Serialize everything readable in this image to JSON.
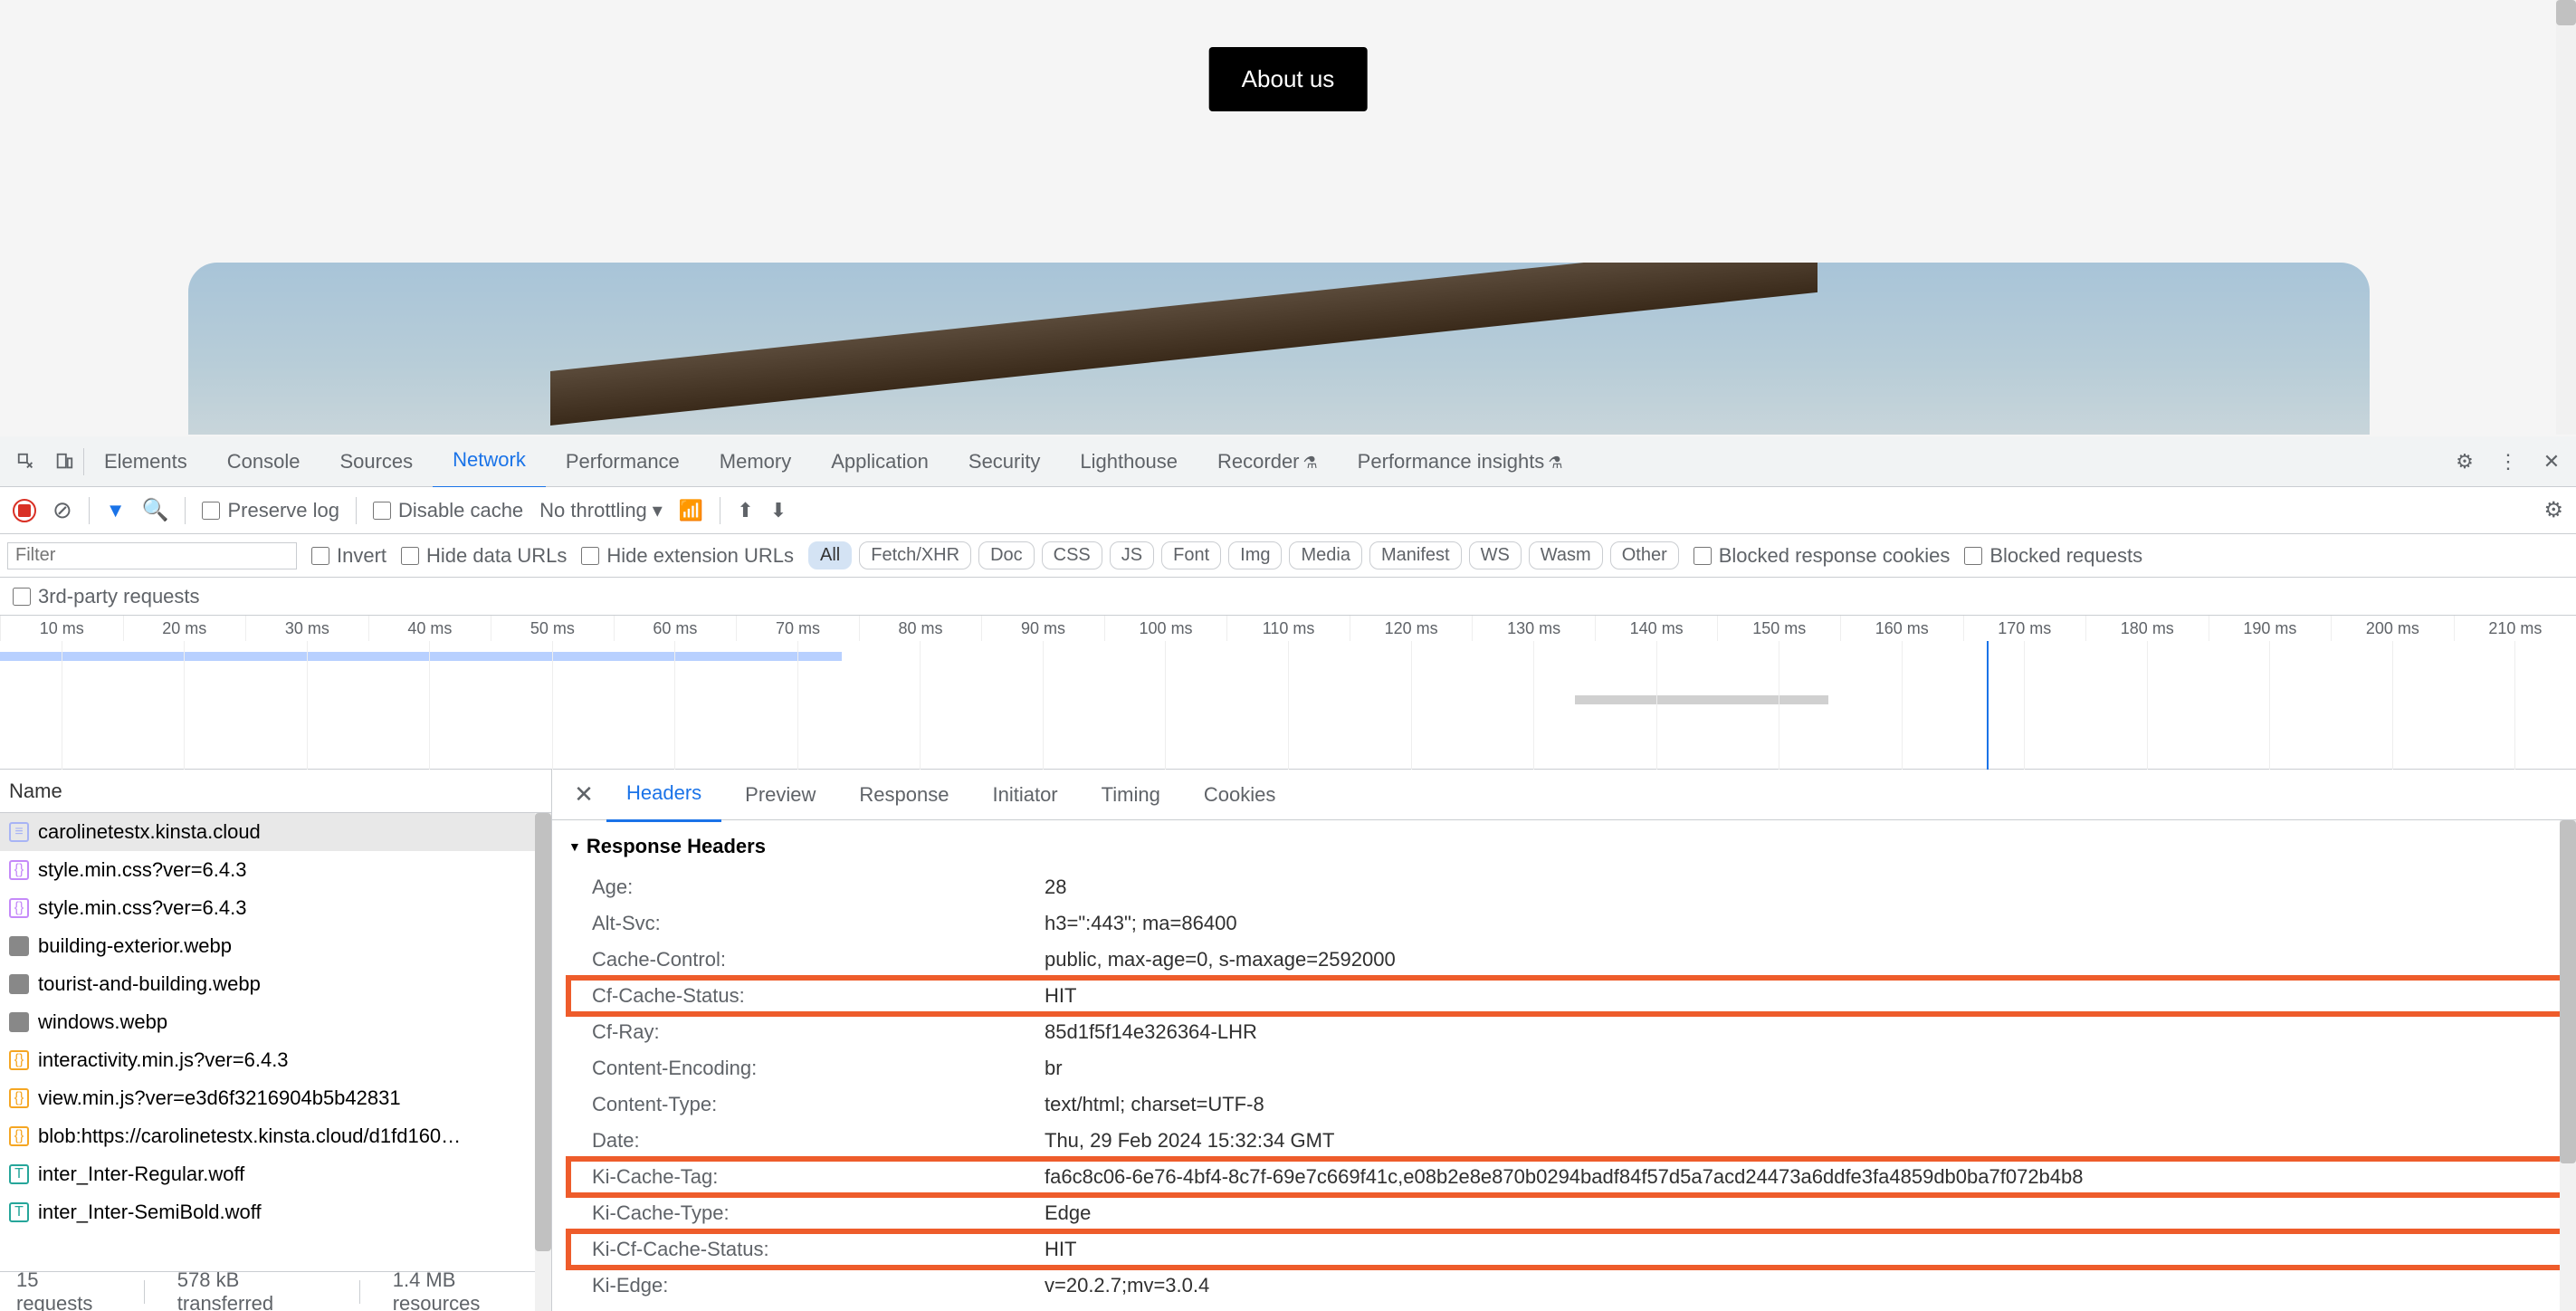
{
  "page": {
    "about_btn": "About us"
  },
  "devtools": {
    "tabs": [
      "Elements",
      "Console",
      "Sources",
      "Network",
      "Performance",
      "Memory",
      "Application",
      "Security",
      "Lighthouse",
      "Recorder",
      "Performance insights"
    ],
    "active_tab": "Network"
  },
  "net_toolbar": {
    "preserve_log": "Preserve log",
    "disable_cache": "Disable cache",
    "throttling": "No throttling"
  },
  "filter_bar": {
    "filter_placeholder": "Filter",
    "invert": "Invert",
    "hide_data": "Hide data URLs",
    "hide_ext": "Hide extension URLs",
    "types": [
      "All",
      "Fetch/XHR",
      "Doc",
      "CSS",
      "JS",
      "Font",
      "Img",
      "Media",
      "Manifest",
      "WS",
      "Wasm",
      "Other"
    ],
    "blocked_cookies": "Blocked response cookies",
    "blocked_req": "Blocked requests",
    "third_party": "3rd-party requests"
  },
  "timeline": {
    "ticks": [
      "10 ms",
      "20 ms",
      "30 ms",
      "40 ms",
      "50 ms",
      "60 ms",
      "70 ms",
      "80 ms",
      "90 ms",
      "100 ms",
      "110 ms",
      "120 ms",
      "130 ms",
      "140 ms",
      "150 ms",
      "160 ms",
      "170 ms",
      "180 ms",
      "190 ms",
      "200 ms",
      "210 ms"
    ]
  },
  "requests": {
    "header": "Name",
    "rows": [
      {
        "icon": "doc",
        "name": "carolinetestx.kinsta.cloud"
      },
      {
        "icon": "css",
        "name": "style.min.css?ver=6.4.3"
      },
      {
        "icon": "css",
        "name": "style.min.css?ver=6.4.3"
      },
      {
        "icon": "img",
        "name": "building-exterior.webp"
      },
      {
        "icon": "img",
        "name": "tourist-and-building.webp"
      },
      {
        "icon": "img",
        "name": "windows.webp"
      },
      {
        "icon": "js",
        "name": "interactivity.min.js?ver=6.4.3"
      },
      {
        "icon": "js",
        "name": "view.min.js?ver=e3d6f3216904b5b42831"
      },
      {
        "icon": "js",
        "name": "blob:https://carolinetestx.kinsta.cloud/d1fd160…"
      },
      {
        "icon": "font",
        "name": "inter_Inter-Regular.woff"
      },
      {
        "icon": "font",
        "name": "inter_Inter-SemiBold.woff"
      }
    ]
  },
  "details": {
    "tabs": [
      "Headers",
      "Preview",
      "Response",
      "Initiator",
      "Timing",
      "Cookies"
    ],
    "section": "Response Headers",
    "headers": [
      {
        "k": "Age:",
        "v": "28"
      },
      {
        "k": "Alt-Svc:",
        "v": "h3=\":443\"; ma=86400"
      },
      {
        "k": "Cache-Control:",
        "v": "public, max-age=0, s-maxage=2592000"
      },
      {
        "k": "Cf-Cache-Status:",
        "v": "HIT",
        "hl": true
      },
      {
        "k": "Cf-Ray:",
        "v": "85d1f5f14e326364-LHR"
      },
      {
        "k": "Content-Encoding:",
        "v": "br"
      },
      {
        "k": "Content-Type:",
        "v": "text/html; charset=UTF-8"
      },
      {
        "k": "Date:",
        "v": "Thu, 29 Feb 2024 15:32:34 GMT"
      },
      {
        "k": "Ki-Cache-Tag:",
        "v": "fa6c8c06-6e76-4bf4-8c7f-69e7c669f41c,e08b2e8e870b0294badf84f57d5a7acd24473a6ddfe3fa4859db0ba7f072b4b8",
        "hl": true
      },
      {
        "k": "Ki-Cache-Type:",
        "v": "Edge"
      },
      {
        "k": "Ki-Cf-Cache-Status:",
        "v": "HIT",
        "hl": true
      },
      {
        "k": "Ki-Edge:",
        "v": "v=20.2.7;mv=3.0.4"
      }
    ]
  },
  "status": {
    "requests": "15 requests",
    "transferred": "578 kB transferred",
    "resources": "1.4 MB resources"
  }
}
